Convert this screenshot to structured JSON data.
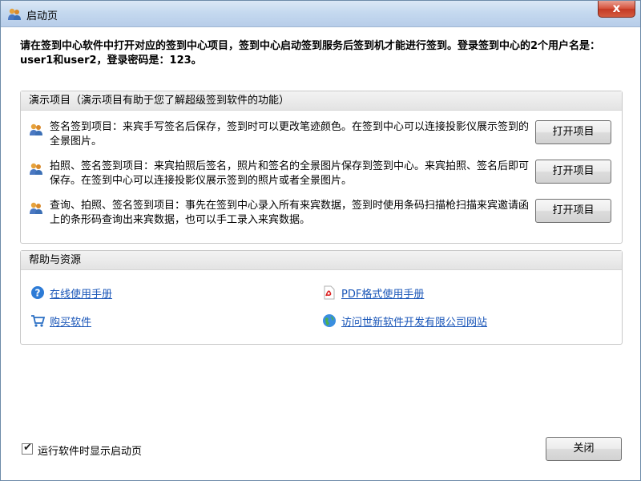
{
  "window": {
    "title": "启动页",
    "close_glyph": "x"
  },
  "intro": "请在签到中心软件中打开对应的签到中心项目，签到中心启动签到服务后签到机才能进行签到。登录签到中心的2个用户名是：user1和user2，登录密码是：123。",
  "demo": {
    "header": "演示项目（演示项目有助于您了解超级签到软件的功能）",
    "projects": [
      {
        "text": "签名签到项目：来宾手写签名后保存，签到时可以更改笔迹颜色。在签到中心可以连接投影仪展示签到的全景图片。",
        "button": "打开项目",
        "icon": "users-icon"
      },
      {
        "text": "拍照、签名签到项目：来宾拍照后签名，照片和签名的全景图片保存到签到中心。来宾拍照、签名后即可保存。在签到中心可以连接投影仪展示签到的照片或者全景图片。",
        "button": "打开项目",
        "icon": "users-icon"
      },
      {
        "text": "查询、拍照、签名签到项目：事先在签到中心录入所有来宾数据，签到时使用条码扫描枪扫描来宾邀请函上的条形码查询出来宾数据，也可以手工录入来宾数据。",
        "button": "打开项目",
        "icon": "users-icon"
      }
    ]
  },
  "help": {
    "header": "帮助与资源",
    "links": {
      "online_manual": "在线使用手册",
      "pdf_manual": "PDF格式使用手册",
      "buy": "购买软件",
      "visit_site": "访问世新软件开发有限公司网站"
    }
  },
  "footer": {
    "show_on_start_label": "运行软件时显示启动页",
    "show_on_start_checked": true,
    "check_mark": "✔",
    "close_button": "关闭"
  }
}
